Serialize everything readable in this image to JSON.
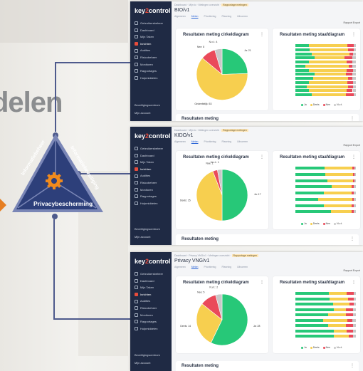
{
  "background": {
    "title": "delen"
  },
  "triangle": {
    "left": "Informatiebeheer",
    "right": "Informatiebeveiliging",
    "bottom": "Privacybescherming",
    "colors": {
      "fill": "#2d3f7a",
      "rim": "#7a86b6",
      "gear": "#f08a1c"
    }
  },
  "screens": [
    {
      "logo_a": "key",
      "logo_b": "2",
      "logo_c": "control",
      "title": "BIO/v1",
      "crumbs": "Dashboard · Mijn to · Metingen overzicht · Rapportage metingen",
      "crumb_current": "Rapportage metingen",
      "tabs": [
        "Algemeen",
        "Meten",
        "Prioritering",
        "Planning",
        "Uitvoeren"
      ],
      "export": "Rapport Export",
      "nav": [
        "Gebruikersbeheer",
        "Dashboard",
        "Mijn Taken",
        "Inrichten",
        "Audities",
        "Risicobeheer",
        "Monitoren",
        "Rapportages",
        "Hulpmiddelen"
      ],
      "active": 3,
      "foot": [
        "Beveiligingscentrum",
        "Mijn account"
      ],
      "pie_title": "Resultaten meting cirkeldiagram",
      "bar_title": "Resultaten meting staafdiagram",
      "bottom_title": "Resultaten meting",
      "pie": {
        "values": [
          21,
          53,
          8,
          4
        ],
        "labels": [
          "Ja: 21",
          "Gedeeltelijk: 53",
          "Nee: 8",
          "N.v.t.: 4"
        ]
      },
      "legend": [
        "Ja",
        "Deels",
        "Nee",
        "N.v.t."
      ]
    },
    {
      "logo_a": "key",
      "logo_b": "2",
      "logo_c": "control",
      "title": "KIDO/v1",
      "crumbs": "Dashboard · Mijn to · Metingen overzicht · Rapportage metingen",
      "crumb_current": "Rapportage metingen",
      "tabs": [
        "Algemeen",
        "Meten",
        "Prioritering",
        "Planning",
        "Uitvoeren"
      ],
      "export": "Rapport Export",
      "nav": [
        "Gebruikersbeheer",
        "Dashboard",
        "Mijn Taken",
        "Inrichten",
        "Audities",
        "Risicobeheer",
        "Monitoren",
        "Rapportages",
        "Hulpmiddelen"
      ],
      "active": 3,
      "foot": [
        "Beveiligingscentrum",
        "Mijn account"
      ],
      "pie_title": "Resultaten meting cirkeldiagram",
      "bar_title": "Resultaten meting staafdiagram",
      "bottom_title": "Resultaten meting",
      "pie": {
        "values": [
          17,
          15,
          1,
          1
        ],
        "labels": [
          "Ja: 17",
          "Deels: 15",
          "Nee: 1",
          "N.v.t.: 1"
        ]
      },
      "legend": [
        "Ja",
        "Deels",
        "Nee",
        "N.v.t."
      ]
    },
    {
      "logo_a": "key",
      "logo_b": "2",
      "logo_c": "control",
      "title": "Privacy VNG/v1",
      "crumbs": "Dashboard · Privacy VNG/v1 · Metingen overzicht · Rapportage metingen",
      "crumb_current": "Rapportage metingen",
      "tabs": [
        "Algemeen",
        "Meten",
        "Prioritering",
        "Planning",
        "Uitvoeren"
      ],
      "export": "Rapport Export",
      "nav": [
        "Gebruikersbeheer",
        "Dashboard",
        "Mijn Taken",
        "Inrichten",
        "Audities",
        "Risicobeheer",
        "Monitoren",
        "Rapportages",
        "Hulpmiddelen"
      ],
      "active": 3,
      "foot": [
        "Beveiligingscentrum",
        "Mijn account"
      ],
      "pie_title": "Resultaten meting cirkeldiagram",
      "bar_title": "Resultaten meting staafdiagram",
      "bottom_title": "Resultaten meting",
      "pie": {
        "values": [
          28,
          14,
          5,
          2
        ],
        "labels": [
          "Ja: 28",
          "Deels: 14",
          "Nee: 5",
          "N.v.t.: 2"
        ]
      },
      "legend": [
        "Ja",
        "Deels",
        "Nee",
        "N.v.t."
      ]
    }
  ],
  "palette": {
    "ja": "#27c878",
    "deels": "#f7cf4f",
    "nee": "#ea4a5a",
    "nvt": "#c8c8c8"
  }
}
